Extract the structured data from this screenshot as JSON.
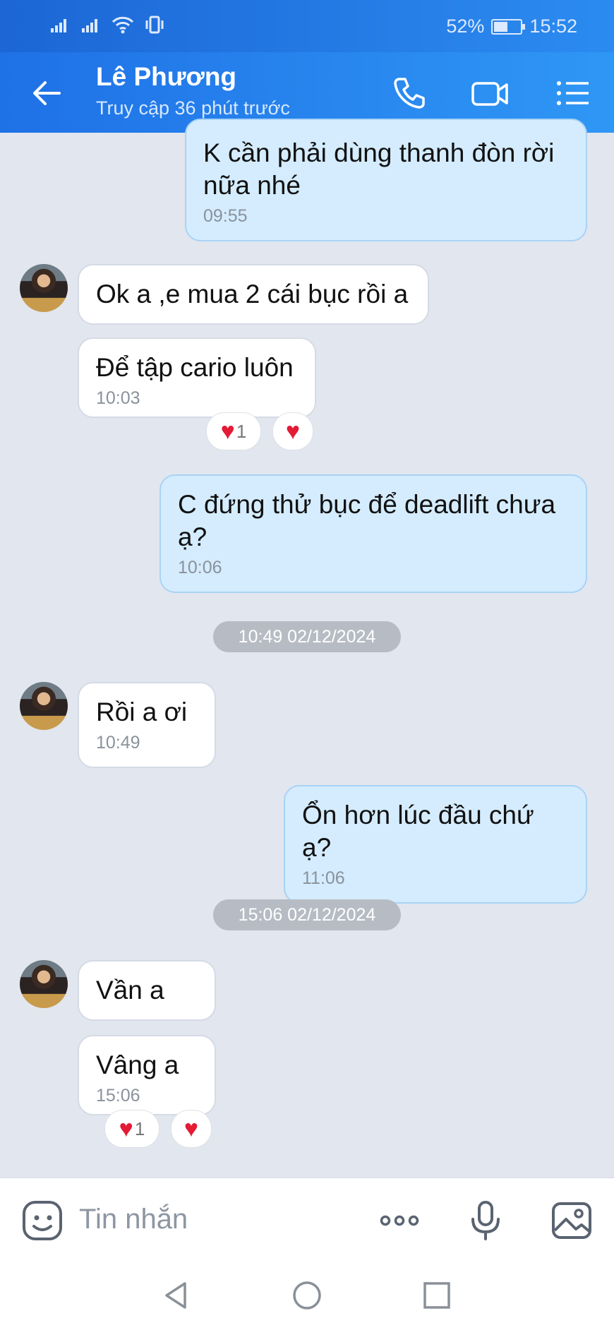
{
  "status_bar": {
    "battery": "52%",
    "battery_level": 0.52,
    "time": "15:52"
  },
  "header": {
    "contact_name": "Lê Phương",
    "contact_status": "Truy cập 36 phút trước",
    "icons": [
      "back-arrow-icon",
      "phone-icon",
      "video-call-icon",
      "menu-list-icon"
    ]
  },
  "messages": [
    {
      "dir": "out",
      "text": "K cần phải dùng thanh đòn rời nữa nhé",
      "time": "09:55"
    },
    {
      "dir": "in",
      "text": "Ok a ,e mua 2 cái bục rồi a"
    },
    {
      "dir": "in",
      "text": "Để tập cario luôn",
      "time": "10:03",
      "reaction_count": "1"
    },
    {
      "dir": "out",
      "text": "C đứng thử bục để deadlift chưa ạ?",
      "time": "10:06"
    },
    {
      "dir": "in",
      "text": "Rồi a ơi",
      "time": "10:49"
    },
    {
      "dir": "out",
      "text": "Ổn hơn lúc đầu chứ ạ?",
      "time": "11:06"
    },
    {
      "dir": "in",
      "text": "Vần a"
    },
    {
      "dir": "in",
      "text": "Vâng a",
      "time": "15:06",
      "reaction_count": "1"
    }
  ],
  "dividers": [
    "10:49 02/12/2024",
    "15:06 02/12/2024"
  ],
  "composer": {
    "placeholder": "Tin nhắn"
  },
  "colors": {
    "header": "#2b8bf0",
    "outgoing_bubble": "#d4ecfe",
    "chat_background": "#e2e6ee",
    "heart": "#e31b35"
  }
}
